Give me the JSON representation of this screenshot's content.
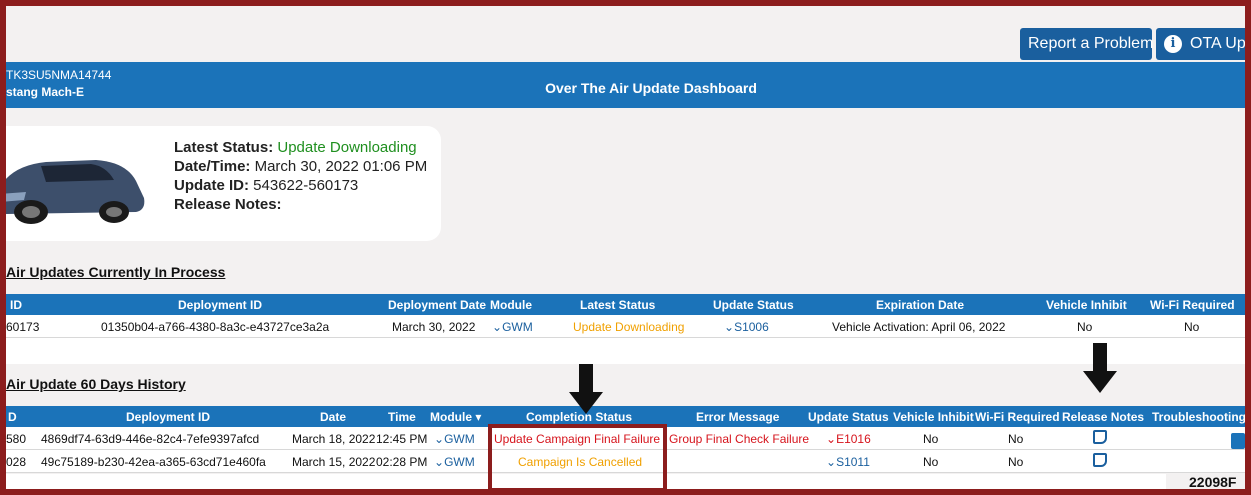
{
  "top_buttons": {
    "report": "Report a Problem",
    "ota": "OTA Upd"
  },
  "header": {
    "vin": "TK3SU5NMA14744",
    "vehicle": "stang Mach-E",
    "title": "Over The Air Update Dashboard"
  },
  "status_card": {
    "latest_status_label": "Latest Status:",
    "latest_status_value": "Update Downloading",
    "datetime_label": "Date/Time:",
    "datetime_value": "March 30, 2022 01:06 PM",
    "update_id_label": "Update ID:",
    "update_id_value": "543622-560173",
    "release_notes_label": "Release Notes:"
  },
  "in_process": {
    "title": "Air Updates Currently In Process",
    "headers": {
      "id": "ID",
      "deployment_id": "Deployment ID",
      "deployment_date": "Deployment Date",
      "module": "Module",
      "latest_status": "Latest Status",
      "update_status": "Update Status",
      "expiration": "Expiration Date",
      "inhibit": "Vehicle Inhibit",
      "wifi": "Wi-Fi Required"
    },
    "row": {
      "id": "60173",
      "deployment_id": "01350b04-a766-4380-8a3c-e43727ce3a2a",
      "deployment_date": "March 30, 2022",
      "module": "GWM",
      "latest_status": "Update Downloading",
      "update_status": "S1006",
      "expiration": "Vehicle Activation: April 06, 2022",
      "inhibit": "No",
      "wifi": "No"
    }
  },
  "history": {
    "title": "Air Update 60 Days History",
    "headers": {
      "id": "D",
      "deployment_id": "Deployment ID",
      "date": "Date",
      "time": "Time",
      "module": "Module",
      "completion": "Completion Status",
      "error": "Error Message",
      "update_status": "Update Status",
      "inhibit": "Vehicle Inhibit",
      "wifi": "Wi-Fi Required",
      "notes": "Release Notes",
      "trouble": "Troubleshooting R"
    },
    "rows": [
      {
        "id": "580",
        "deployment_id": "4869df74-63d9-446e-82c4-7efe9397afcd",
        "date": "March 18, 2022",
        "time": "12:45 PM",
        "module": "GWM",
        "completion": "Update Campaign Final Failure",
        "error": "Group Final Check Failure",
        "update_status": "E1016",
        "inhibit": "No",
        "wifi": "No"
      },
      {
        "id": "028",
        "deployment_id": "49c75189-b230-42ea-a365-63cd71e460fa",
        "date": "March 15, 2022",
        "time": "02:28 PM",
        "module": "GWM",
        "completion": "Campaign Is Cancelled",
        "error": "",
        "update_status": "S1011",
        "inhibit": "No",
        "wifi": "No"
      }
    ]
  },
  "figure_code": "22098F",
  "colors": {
    "brand_blue": "#1b73b9",
    "highlight": "#8c1d1d",
    "status_orange": "#f0a000",
    "error_red": "#d6141c",
    "ok_green": "#1f8f1f"
  }
}
